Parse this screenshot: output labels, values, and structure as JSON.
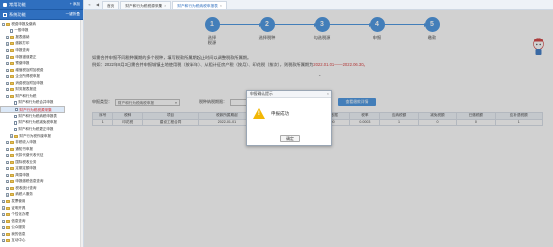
{
  "sidebar": {
    "header1_title": "常用功能",
    "header1_action": "+ 添加",
    "header2_title": "系统功能",
    "header2_action": "一键折叠",
    "items": [
      {
        "label": "税费申报及缴纳",
        "type": "folder",
        "exp": "−",
        "indent": 0
      },
      {
        "label": "一般申报",
        "type": "doc",
        "exp": "",
        "indent": 1
      },
      {
        "label": "报表缴纳",
        "type": "folder",
        "exp": "+",
        "indent": 1
      },
      {
        "label": "缴款打印",
        "type": "folder",
        "exp": "+",
        "indent": 1
      },
      {
        "label": "申报查询",
        "type": "folder",
        "exp": "+",
        "indent": 1
      },
      {
        "label": "申报错误更正",
        "type": "folder",
        "exp": "+",
        "indent": 1
      },
      {
        "label": "预缴申报",
        "type": "folder",
        "exp": "+",
        "indent": 1
      },
      {
        "label": "增值税及附加税费",
        "type": "folder",
        "exp": "+",
        "indent": 1
      },
      {
        "label": "企业所得税申报",
        "type": "folder",
        "exp": "+",
        "indent": 1
      },
      {
        "label": "消费税及附加申报",
        "type": "folder",
        "exp": "+",
        "indent": 1
      },
      {
        "label": "财务报表报送",
        "type": "folder",
        "exp": "+",
        "indent": 1
      },
      {
        "label": "财产和行为税",
        "type": "folder",
        "exp": "−",
        "indent": 1
      },
      {
        "label": "财产和行为税合并申报",
        "type": "doc",
        "exp": "",
        "indent": 2
      },
      {
        "label": "财产行为税税源采集",
        "type": "doc",
        "exp": "",
        "indent": 2,
        "selected": true
      },
      {
        "label": "财产和行为税纳税申报表",
        "type": "doc",
        "exp": "",
        "indent": 2
      },
      {
        "label": "财产和行为税减免税申报",
        "type": "doc",
        "exp": "",
        "indent": 2
      },
      {
        "label": "财产和行为税更正申报",
        "type": "doc",
        "exp": "",
        "indent": 2
      },
      {
        "label": "财产行为税作废申报",
        "type": "folder",
        "exp": "+",
        "indent": 2
      },
      {
        "label": "非税收入申报",
        "type": "folder",
        "exp": "+",
        "indent": 1
      },
      {
        "label": "通知书申报",
        "type": "folder",
        "exp": "+",
        "indent": 1
      },
      {
        "label": "代扣代缴代收代征",
        "type": "folder",
        "exp": "+",
        "indent": 1
      },
      {
        "label": "国际税收业务",
        "type": "folder",
        "exp": "+",
        "indent": 1
      },
      {
        "label": "定期定额申报",
        "type": "folder",
        "exp": "+",
        "indent": 1
      },
      {
        "label": "简易申报",
        "type": "folder",
        "exp": "+",
        "indent": 1
      },
      {
        "label": "申报缴税信息查询",
        "type": "folder",
        "exp": "+",
        "indent": 1
      },
      {
        "label": "税收统计查询",
        "type": "folder",
        "exp": "+",
        "indent": 1
      },
      {
        "label": "纳税人服务",
        "type": "folder",
        "exp": "+",
        "indent": 1
      },
      {
        "label": "发票使用",
        "type": "folder",
        "exp": "+",
        "indent": 0
      },
      {
        "label": "证明开具",
        "type": "folder",
        "exp": "+",
        "indent": 0
      },
      {
        "label": "个性化办理",
        "type": "folder",
        "exp": "+",
        "indent": 0
      },
      {
        "label": "信息查询",
        "type": "folder",
        "exp": "+",
        "indent": 0
      },
      {
        "label": "公众服务",
        "type": "folder",
        "exp": "+",
        "indent": 0
      },
      {
        "label": "我的信息",
        "type": "folder",
        "exp": "+",
        "indent": 0
      },
      {
        "label": "互动中心",
        "type": "folder",
        "exp": "+",
        "indent": 0
      }
    ]
  },
  "tabs": {
    "nav_prev": "«",
    "nav_back": "◀",
    "home": "首页",
    "tab1": "财产和行为税税源采集",
    "tab2": "财产和行为税纳税申报表",
    "close": "×"
  },
  "stepper": {
    "steps": [
      {
        "num": "1",
        "label": "选择\n税源"
      },
      {
        "num": "2",
        "label": "选择税种"
      },
      {
        "num": "3",
        "label": "勾选税源"
      },
      {
        "num": "4",
        "label": "申报"
      },
      {
        "num": "5",
        "label": "缴款"
      }
    ],
    "accent": "#3b8dde"
  },
  "notice": {
    "line1": "如需合并申报不同税种属期的多个税种，填写税款所属期起止时间以调整税款所属期。",
    "line2_prefix": "例如：2022年8月3日需合并申报城镇土地使用税（按半年）、从租计征房产税（按月）、印花税（按次），则税款所属期为",
    "line2_red": "2022.01.01——2022.06.30。"
  },
  "filter": {
    "label1": "申报类型：",
    "select1_value": "财产和行为税纳税申报",
    "label2": "税种纳税期限：",
    "select2_value": "",
    "button": "查看缴款详情"
  },
  "table": {
    "headers": [
      "序号",
      "税种",
      "项目",
      "税款所属期起",
      "税款所属期止",
      "计税依据",
      "税率",
      "应纳税额",
      "减免税额",
      "已缴税额",
      "应补退税额"
    ],
    "rows": [
      [
        "1",
        "印花税",
        "建设工程合同",
        "2022-01-01",
        "2022-06-30",
        "2000",
        "0.0003",
        "1",
        "0",
        "0",
        "1"
      ]
    ]
  },
  "modal": {
    "title": "申报确认提示",
    "close": "×",
    "message": "申报成功",
    "ok": "确定",
    "warn_symbol": "!"
  }
}
